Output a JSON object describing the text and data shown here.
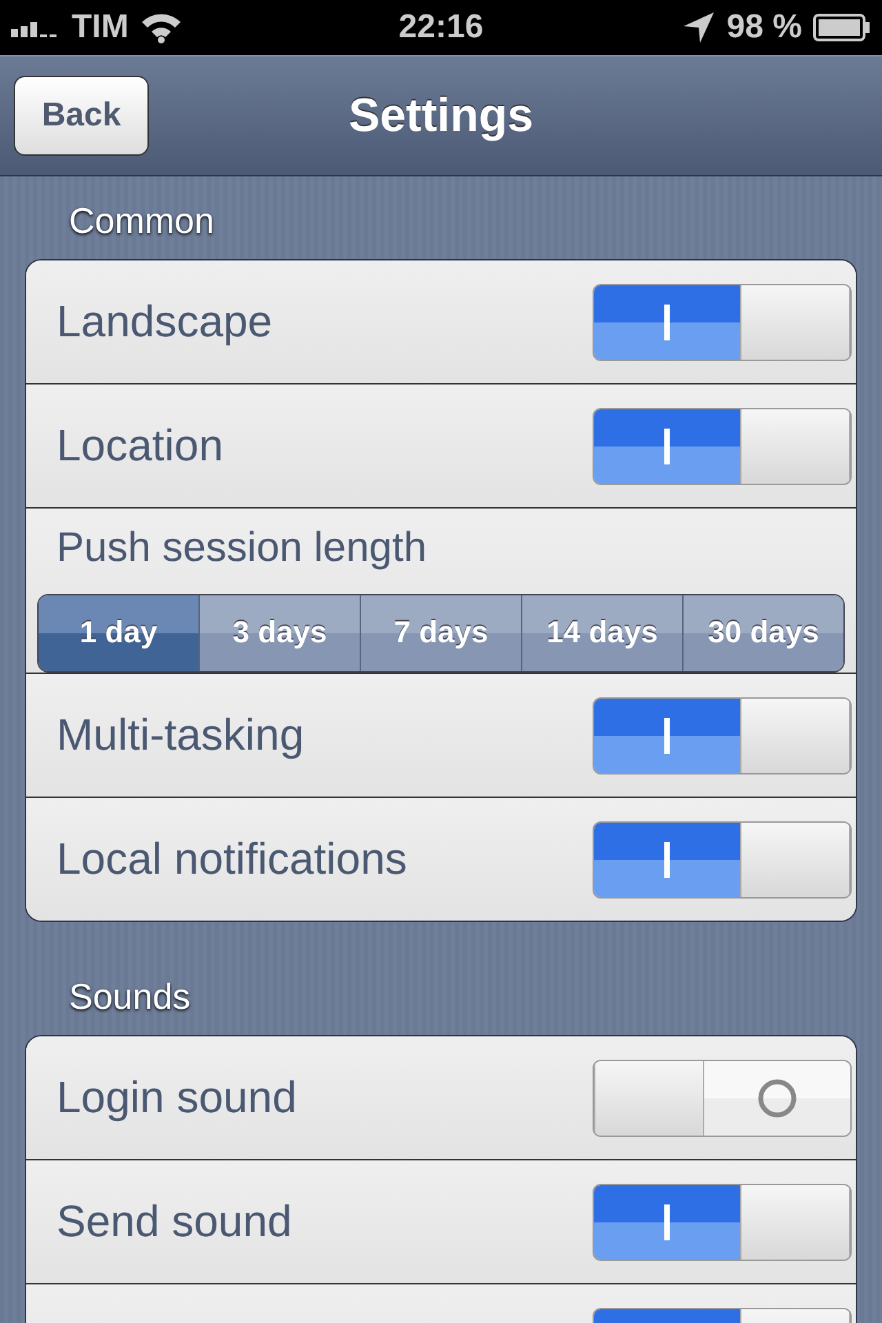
{
  "status_bar": {
    "carrier": "TIM",
    "time": "22:16",
    "battery": "98 %"
  },
  "nav": {
    "back": "Back",
    "title": "Settings"
  },
  "sections": [
    {
      "title": "Common",
      "rows": [
        {
          "kind": "toggle",
          "label": "Landscape",
          "on": true
        },
        {
          "kind": "toggle",
          "label": "Location",
          "on": true
        },
        {
          "kind": "segmented",
          "label": "Push session length",
          "options": [
            {
              "label": "1 day",
              "selected": true
            },
            {
              "label": "3 days",
              "selected": false
            },
            {
              "label": "7 days",
              "selected": false
            },
            {
              "label": "14 days",
              "selected": false
            },
            {
              "label": "30 days",
              "selected": false
            }
          ]
        },
        {
          "kind": "toggle",
          "label": "Multi-tasking",
          "on": true
        },
        {
          "kind": "toggle",
          "label": "Local notifications",
          "on": true
        }
      ]
    },
    {
      "title": "Sounds",
      "rows": [
        {
          "kind": "toggle",
          "label": "Login sound",
          "on": false
        },
        {
          "kind": "toggle",
          "label": "Send sound",
          "on": true
        },
        {
          "kind": "toggle",
          "on": true
        }
      ]
    }
  ]
}
